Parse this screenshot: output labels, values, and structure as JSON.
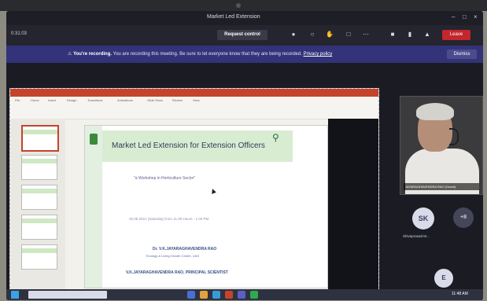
{
  "window": {
    "title": "Market Led Extension",
    "controls": [
      "–",
      "□",
      "×"
    ]
  },
  "toolbar": {
    "timer": "0:31:03",
    "request_control": "Request control",
    "icons": [
      "people-icon",
      "chat-icon",
      "raise-hand-icon",
      "rooms-icon",
      "more-icon",
      "camera-icon",
      "mic-icon",
      "share-icon"
    ],
    "leave_label": "Leave"
  },
  "banner": {
    "lead": "You're recording.",
    "message": "You are recording this meeting. Be sure to let everyone know that they are being recorded.",
    "link": "Privacy policy",
    "dismiss": "Dismiss"
  },
  "slide": {
    "title": "Market Led Extension for Extension Officers",
    "subtitle": "\"a Workshop in Horticulture Sector\"",
    "date": "20.09.2021 (Saturday) from 11.00 Hours - 1.00 PM",
    "presenter": "Dr. V.K.JAYARAGHAVENDRA RAO",
    "presenter_sub": "Ecology & Living Growth Centre, UAS",
    "footer": "V.K.JAYARAGHAVENDRA RAO, PRINCIPAL SCIENTIST"
  },
  "ribbon": {
    "tabs": [
      "File",
      "Home",
      "Insert",
      "Design",
      "Transitions",
      "Animations",
      "Slide Show",
      "Review",
      "View"
    ]
  },
  "participants": {
    "video_label": "JAYARAGHAVENDRA RAO (Guest)",
    "sk_initials": "SK",
    "sk_name": "Shivaprasad M...",
    "more_count": "+8",
    "e_initials": "E"
  },
  "taskbar": {
    "clock": "11:48 AM"
  },
  "colors": {
    "banner": "#33337a",
    "leave": "#c4262e",
    "ppt": "#c6432b"
  }
}
